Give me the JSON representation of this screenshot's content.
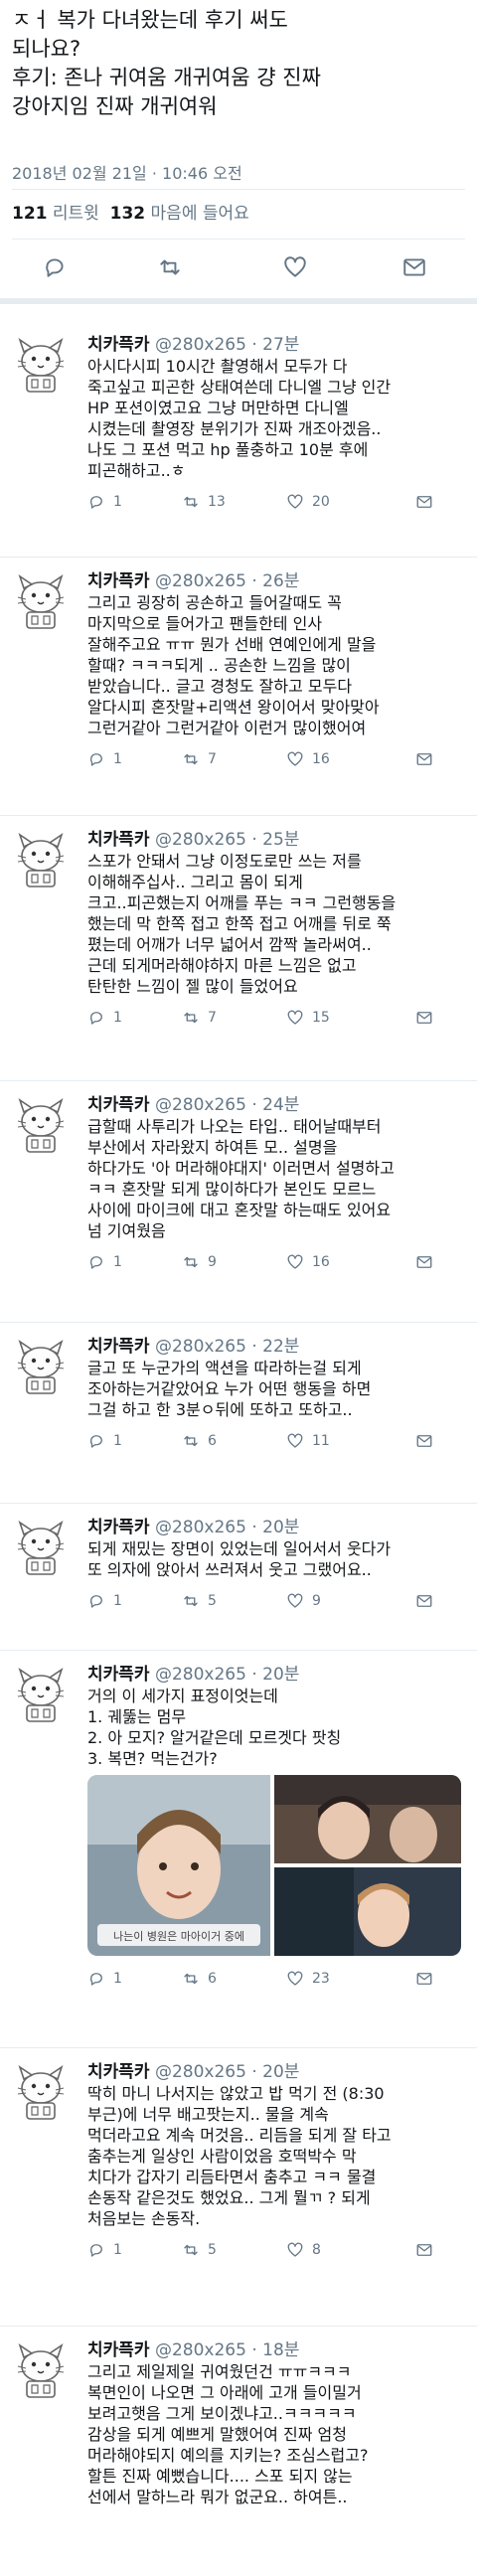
{
  "header": {
    "lines": [
      "ㅈㅓ 복가 다녀왔는데 후기 써도",
      "되나요?",
      "후기: 존나 귀여움 개귀여움 걍 진짜",
      "강아지임 진짜 개귀여워"
    ],
    "timestamp": "2018년 02월 21일 · 10:46 오전",
    "retweets_count": "121",
    "retweets_label": "리트윗",
    "likes_count": "132",
    "likes_label": "마음에 들어요"
  },
  "colors": {
    "text": "#14171a",
    "secondary": "#657786",
    "divider": "#e6ecf0",
    "accent": "#1da1f2"
  },
  "tweets": [
    {
      "name": "치카픅카",
      "handle": "@280x265",
      "time": "· 27분",
      "lines": [
        "아시다시피 10시간 촬영해서 모두가 다",
        "죽고싶고 피곤한 상태여쓴데 다니엘 그냥 인간",
        "HP 포션이였고요 그냥 머만하면 다니엘",
        "시켰는데 촬영장 분위기가 진짜 개조아겠음..",
        "나도 그 포션 먹고 hp 풀충하고 10분 후에",
        "피곤해하고..ㅎ"
      ],
      "replies": "1",
      "retweets": "13",
      "likes": "20"
    },
    {
      "name": "치카픅카",
      "handle": "@280x265",
      "time": "· 26분",
      "lines": [
        "그리고 굉장히 공손하고 들어갈때도 꼭",
        "마지막으로 들어가고 팬들한테 인사",
        "잘해주고요 ㅠㅠ 뭔가 선배 연예인에게 말을",
        "할때? ㅋㅋㅋ되게 .. 공손한 느낌을 많이",
        "받았습니다.. 글고 경청도 잘하고 모두다",
        "알다시피 혼잣말+리액션 왕이어서 맞아맞아",
        "그런거같아 그런거같아 이런거 많이했어여"
      ],
      "replies": "1",
      "retweets": "7",
      "likes": "16"
    },
    {
      "name": "치카픅카",
      "handle": "@280x265",
      "time": "· 25분",
      "lines": [
        "스포가 안돼서 그냥 이정도로만 쓰는 저를",
        "이해해주십사.. 그리고 몸이 되게",
        "크고..피곤했는지 어깨를 푸는 ㅋㅋ 그런행동을",
        "했는데 막 한쪽 접고 한쪽 접고 어깨를 뒤로 쭉",
        "폈는데 어깨가 너무 넓어서 깜짝 놀라써여..",
        "근데 되게머라해야하지 마른 느낌은 없고",
        "탄탄한 느낌이 젤 많이 들었어요"
      ],
      "replies": "1",
      "retweets": "7",
      "likes": "15"
    },
    {
      "name": "치카픅카",
      "handle": "@280x265",
      "time": "· 24분",
      "lines": [
        "급할때 사투리가 나오는 타입.. 태어날때부터",
        "부산에서 자라왔지 하여튼 모.. 설명을",
        "하다가도 '아 머라해야대지' 이러면서 설명하고",
        "ㅋㅋ 혼잣말 되게 많이하다가 본인도 모르느",
        "사이에 마이크에 대고 혼잣말 하는때도 있어요",
        "넘 기여웠음"
      ],
      "replies": "1",
      "retweets": "9",
      "likes": "16"
    },
    {
      "name": "치카픅카",
      "handle": "@280x265",
      "time": "· 22분",
      "lines": [
        "글고 또 누군가의 액션을 따라하는걸 되게",
        "조아하는거같았어요 누가 어떤 행동을 하면",
        "그걸 하고 한 3분ㅇ뒤에 또하고 또하고.."
      ],
      "replies": "1",
      "retweets": "6",
      "likes": "11"
    },
    {
      "name": "치카픅카",
      "handle": "@280x265",
      "time": "· 20분",
      "lines": [
        "되게 재밌는 장면이 있었는데 일어서서 웃다가",
        "또 의자에 앉아서 쓰러져서 웃고 그랬어요.."
      ],
      "replies": "1",
      "retweets": "5",
      "likes": "9"
    },
    {
      "name": "치카픅카",
      "handle": "@280x265",
      "time": "· 20분",
      "lines": [
        "거의 이 세가지 표정이엇는데",
        "1. 궤뚫는 멈무",
        "2. 아 모지? 알거같은데 모르겟다 팟칭",
        "3. 복면? 먹는건가?"
      ],
      "image_caption": "나는이 병원은 마아이거 중에",
      "replies": "1",
      "retweets": "6",
      "likes": "23"
    },
    {
      "name": "치카픅카",
      "handle": "@280x265",
      "time": "· 20분",
      "lines": [
        "딱히 마니 나서지는 않았고 밥 먹기 전 (8:30",
        "부근)에 너무 배고팟는지.. 물을 계속",
        "먹더라고요 계속 머것음.. 리듬을 되게 잘 타고",
        "춤추는게 일상인 사람이었음 호떡박수 막",
        "치다가 갑자기 리듬타면서 춤추고 ㅋㅋ 물결",
        "손동작 같은것도 했었요.. 그게 뭘ㄲ ? 되게",
        "처음보는 손동작."
      ],
      "replies": "1",
      "retweets": "5",
      "likes": "8"
    },
    {
      "name": "치카픅카",
      "handle": "@280x265",
      "time": "· 18분",
      "lines": [
        "그리고 제일제일 귀여웠던건 ㅠㅠㅋㅋㅋ",
        "복면인이 나오면 그 아래에 고개 들이밀거",
        "보려고햇음 그게 보이겠냐고..ㅋㅋㅋㅋㅋ",
        "감상을 되게 예쁘게 말했어여 진짜 엄청",
        "머라해야되지 예의를 지키는? 조심스럽고?",
        "할튼 진짜 예뻤습니다.... 스포 되지 않는",
        "선에서 말하느라 뭐가 없군요.. 하여튼.."
      ]
    }
  ]
}
